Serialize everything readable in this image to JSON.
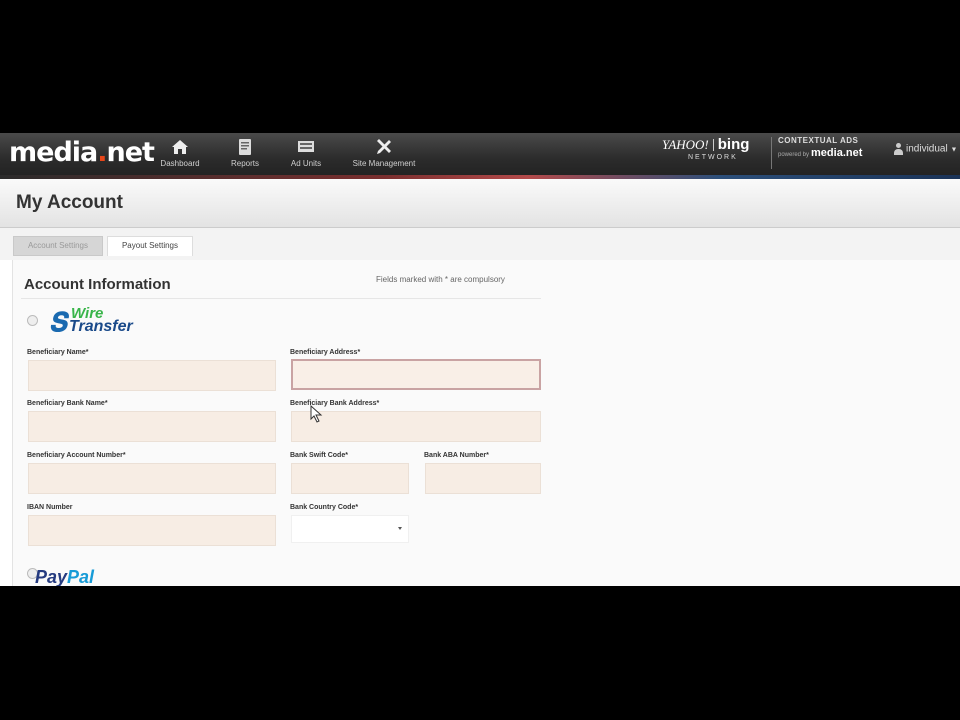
{
  "brand": {
    "logo_main": "media",
    "logo_dot": ".",
    "logo_tail": "net"
  },
  "nav": {
    "items": [
      {
        "label": "Dashboard",
        "icon": "home-icon"
      },
      {
        "label": "Reports",
        "icon": "report-icon"
      },
      {
        "label": "Ad Units",
        "icon": "ad-units-icon"
      },
      {
        "label": "Site Management",
        "icon": "tools-icon"
      }
    ]
  },
  "partner": {
    "yahoo": "YAHOO!",
    "bing": "bing",
    "network": "NETWORK",
    "contextual": "CONTEXTUAL ADS",
    "powered": "powered by",
    "medianet": "media.net"
  },
  "user": {
    "name": "individual"
  },
  "page": {
    "title": "My Account"
  },
  "tabs": [
    {
      "label": "Account Settings",
      "active": false
    },
    {
      "label": "Payout Settings",
      "active": true
    }
  ],
  "section": {
    "title": "Account Information",
    "required_note": "Fields marked with * are compulsory"
  },
  "wire_transfer": {
    "line1": "Wire",
    "line2": "Transfer"
  },
  "fields": {
    "beneficiary_name": {
      "label": "Beneficiary Name",
      "value": ""
    },
    "beneficiary_address": {
      "label": "Beneficiary Address",
      "value": ""
    },
    "beneficiary_bank_name": {
      "label": "Beneficiary Bank Name",
      "value": ""
    },
    "beneficiary_bank_address": {
      "label": "Beneficiary Bank Address",
      "value": ""
    },
    "beneficiary_account_number": {
      "label": "Beneficiary Account Number",
      "value": ""
    },
    "bank_swift_code": {
      "label": "Bank Swift Code",
      "value": ""
    },
    "bank_aba_number": {
      "label": "Bank ABA Number",
      "value": ""
    },
    "iban_number": {
      "label": "IBAN Number",
      "value": ""
    },
    "bank_country_code": {
      "label": "Bank Country Code",
      "value": ""
    }
  },
  "required_mark": "*",
  "paypal": {
    "part1": "Pay",
    "part2": "Pal"
  }
}
